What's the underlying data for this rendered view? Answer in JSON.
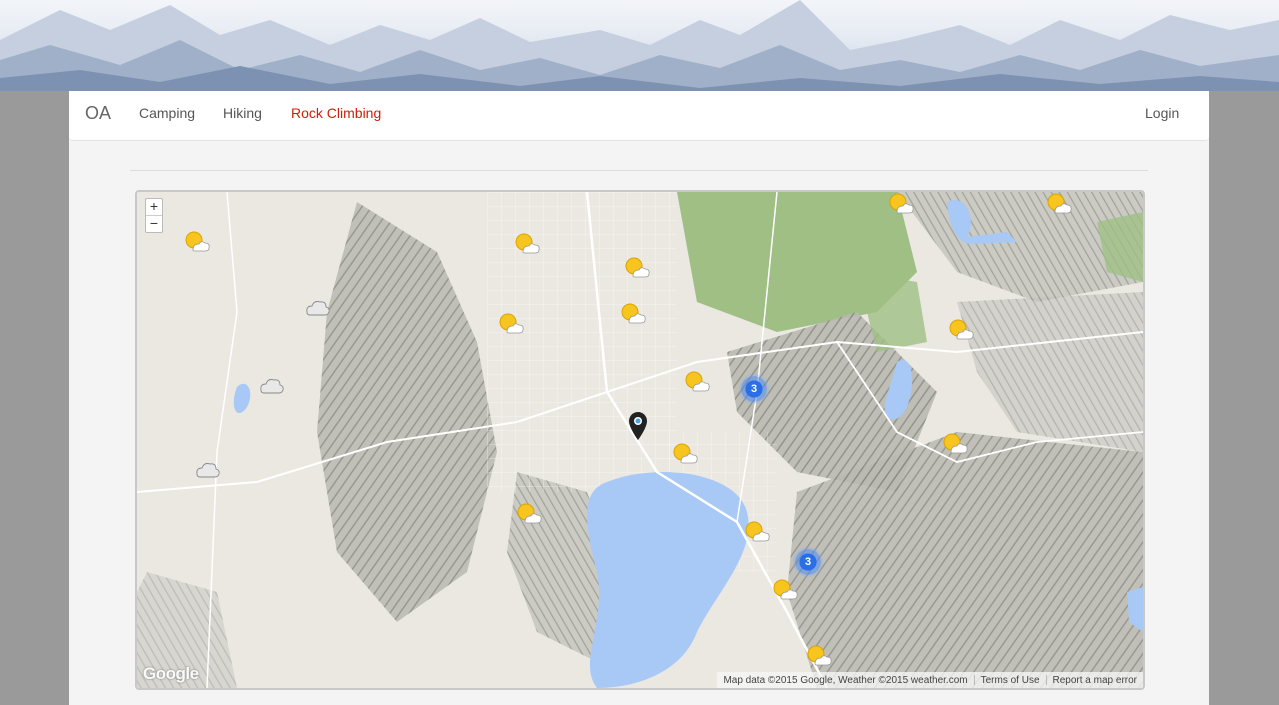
{
  "navbar": {
    "brand": "OA",
    "links": [
      {
        "label": "Camping",
        "active": false
      },
      {
        "label": "Hiking",
        "active": false
      },
      {
        "label": "Rock Climbing",
        "active": true
      }
    ],
    "login_label": "Login"
  },
  "map": {
    "zoom_in_label": "+",
    "zoom_out_label": "−",
    "weather_icons": [
      "sun-cloud-icon",
      "cloud-icon"
    ],
    "clusters": [
      {
        "count": "3"
      },
      {
        "count": "3"
      }
    ],
    "google_logo": "Google",
    "attribution": "Map data ©2015 Google, Weather ©2015 weather.com",
    "terms_label": "Terms of Use",
    "report_label": "Report a map error"
  },
  "colors": {
    "active_nav": "#d01c0c",
    "cluster_blue": "#2b6fe6",
    "water": "#a8c8f5",
    "forest": "#8fb574"
  }
}
